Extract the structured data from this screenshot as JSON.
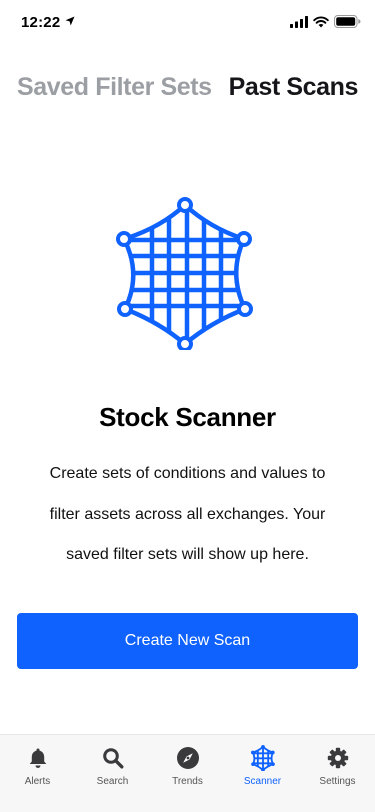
{
  "status_bar": {
    "time": "12:22",
    "location_icon": "location-arrow-icon",
    "signal_icon": "cellular-signal-icon",
    "wifi_icon": "wifi-icon",
    "battery_icon": "battery-icon"
  },
  "top_tabs": [
    {
      "label": "Saved Filter Sets",
      "active": false
    },
    {
      "label": "Past Scans",
      "active": true
    }
  ],
  "empty_state": {
    "icon": "scanner-net-icon",
    "title": "Stock Scanner",
    "description_lines": [
      "Create sets of conditions and values to",
      "filter assets across all exchanges. Your",
      "saved filter sets will show up here."
    ],
    "button_label": "Create New Scan"
  },
  "tab_bar": {
    "items": [
      {
        "label": "Alerts",
        "icon": "bell-icon",
        "active": false
      },
      {
        "label": "Search",
        "icon": "search-icon",
        "active": false
      },
      {
        "label": "Trends",
        "icon": "compass-icon",
        "active": false
      },
      {
        "label": "Scanner",
        "icon": "scanner-net-icon",
        "active": true
      },
      {
        "label": "Settings",
        "icon": "gear-icon",
        "active": false
      }
    ]
  },
  "colors": {
    "accent": "#0f62fe",
    "inactive_tab_text": "#9b9ea3",
    "active_tab_text": "#16161a",
    "tab_bar_bg": "#f7f7f8",
    "tab_icon": "#3a3a3c"
  }
}
